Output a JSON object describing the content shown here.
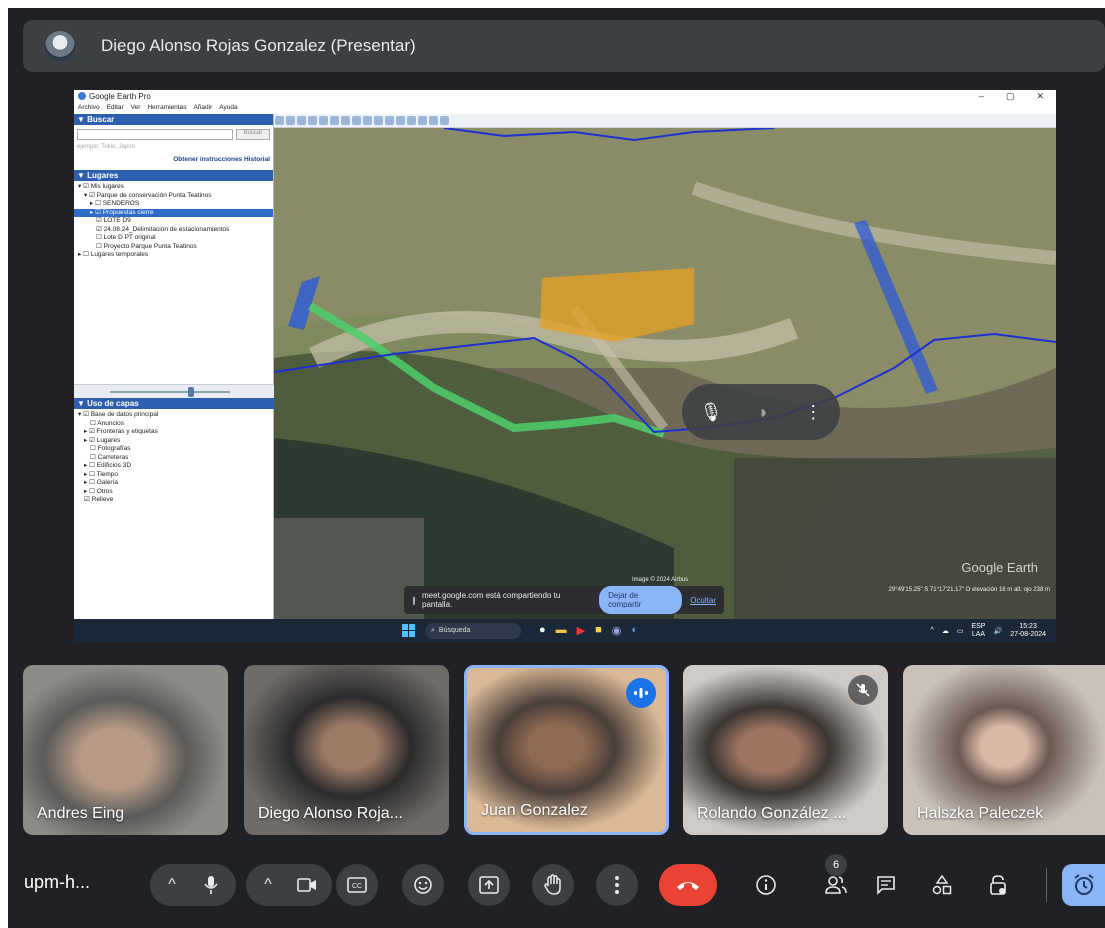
{
  "presenter": {
    "name": "Diego Alonso Rojas Gonzalez (Presentar)"
  },
  "shared_screen": {
    "app_title": "Google Earth Pro",
    "window_controls": [
      "–",
      "▢",
      "✕"
    ],
    "menu": [
      "Archivo",
      "Editar",
      "Ver",
      "Herramientas",
      "Añadir",
      "Ayuda"
    ],
    "search": {
      "header": "▼ Buscar",
      "button": "Buscar",
      "placeholder": "ejemplo: Tokio, Japón",
      "links": "Obtener instrucciones  Historial"
    },
    "places": {
      "header": "▼ Lugares",
      "items": [
        "Mis lugares",
        "Parque de conservación Punta Teatinos",
        "SENDEROS",
        "Propuestas cierre",
        "LOTE D9",
        "24.08.24_Delimitación de estacionamientos",
        "Lote D PT original",
        "Proyecto Parque Punta Teatinos",
        "Lugares temporales"
      ]
    },
    "layers": {
      "header": "▼ Uso de capas",
      "items": [
        "Base de datos principal",
        "Anuncios",
        "Fronteras y etiquetas",
        "Lugares",
        "Fotografías",
        "Carreteras",
        "Edificios 3D",
        "Tiempo",
        "Galería",
        "Otros",
        "Relieve"
      ]
    },
    "map": {
      "image_credit": "Image © 2024 Airbus",
      "watermark": "Google Earth",
      "status": "29°49'15.25\" S   71°17'21.17\" O   elevación   16 m   alt. ojo   238 m"
    },
    "share_notice": {
      "text": "meet.google.com está compartiendo tu pantalla.",
      "stop_label": "Dejar de compartir",
      "hide_label": "Ocultar"
    },
    "taskbar": {
      "search_label": "Búsqueda",
      "lang_top": "ESP",
      "lang_bottom": "LAA",
      "time": "15:23",
      "date": "27-08-2024"
    }
  },
  "participants": [
    {
      "name": "Andres Eing",
      "state": "none"
    },
    {
      "name": "Diego Alonso Roja...",
      "state": "none"
    },
    {
      "name": "Juan Gonzalez",
      "state": "speaking"
    },
    {
      "name": "Rolando González ...",
      "state": "muted"
    },
    {
      "name": "Halszka Paleczek",
      "state": "none"
    }
  ],
  "controls": {
    "meeting_code": "upm-h...",
    "participant_count": "6"
  },
  "colors": {
    "background": "#202124",
    "surface": "#3c4043",
    "accent": "#8ab4f8",
    "speaking": "#1a73e8",
    "leave": "#ea4335"
  }
}
